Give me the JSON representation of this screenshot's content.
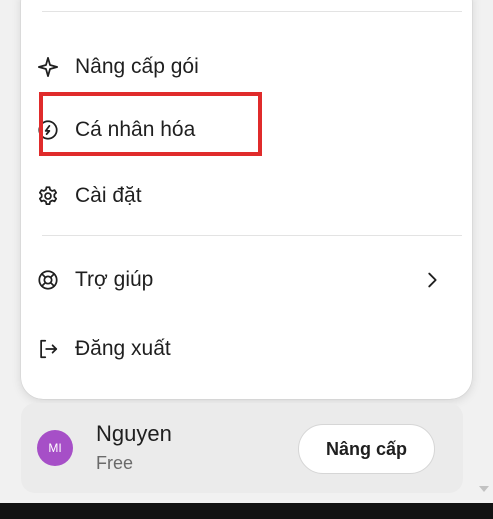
{
  "menu": {
    "items": [
      {
        "label": "Nâng cấp gói",
        "icon": "sparkle-icon"
      },
      {
        "label": "Cá nhân hóa",
        "icon": "personalize-icon"
      },
      {
        "label": "Cài đặt",
        "icon": "gear-icon"
      },
      {
        "label": "Trợ giúp",
        "icon": "lifebuoy-icon",
        "has_submenu": true
      },
      {
        "label": "Đăng xuất",
        "icon": "logout-icon"
      }
    ]
  },
  "user": {
    "initials": "MI",
    "name": "Nguyen",
    "plan": "Free",
    "upgrade_label": "Nâng cấp"
  },
  "colors": {
    "highlight": "#e02b2b",
    "avatar": "#a64fc7"
  }
}
